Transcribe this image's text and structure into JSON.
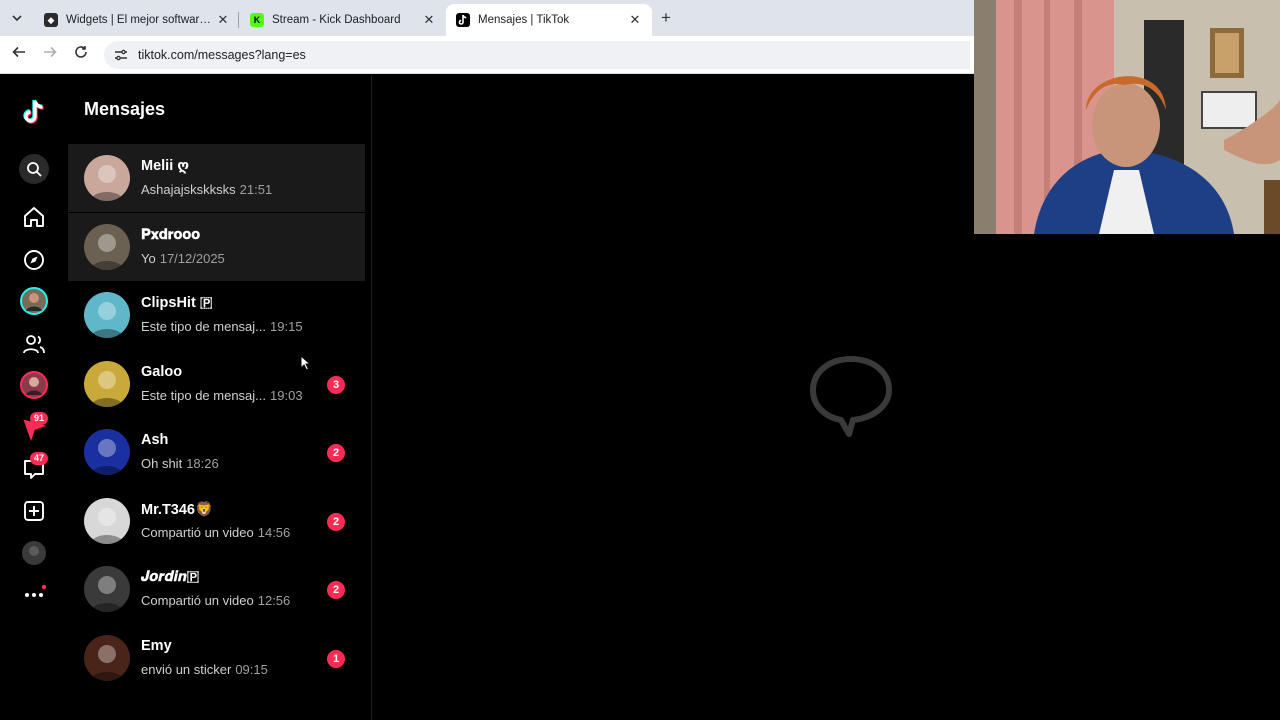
{
  "browser": {
    "tabs": [
      {
        "title": "Widgets | El mejor software pa",
        "favicon": "widgets-icon",
        "active": false
      },
      {
        "title": "Stream - Kick Dashboard",
        "favicon": "kick-icon",
        "active": false
      },
      {
        "title": "Mensajes | TikTok",
        "favicon": "tiktok-icon",
        "active": true
      }
    ],
    "close_glyph": "✕",
    "new_tab_glyph": "+",
    "url": "tiktok.com/messages?lang=es"
  },
  "app": {
    "title": "Mensajes",
    "rail": {
      "notifications_badge": "91",
      "inbox_badge": "47"
    },
    "conversations": [
      {
        "name": "Melii ღ",
        "preview": "Ashajajskskksks",
        "time": "21:51",
        "unread": "",
        "highlight": true,
        "avatar_color": "#c9a79a"
      },
      {
        "name": "𝐏𝐱𝐝𝐫𝐨𝐨𝐨",
        "preview": "Yo",
        "time": "17/12/2025",
        "unread": "",
        "highlight": true,
        "avatar_color": "#6b6152"
      },
      {
        "name": "ClipsHit 🇵",
        "preview": "Este tipo de mensaj...",
        "time": "19:15",
        "unread": "",
        "highlight": false,
        "avatar_color": "#5fb7c9"
      },
      {
        "name": "Galoo",
        "preview": "Este tipo de mensaj...",
        "time": "19:03",
        "unread": "3",
        "highlight": false,
        "avatar_color": "#c9a93a"
      },
      {
        "name": "Ash",
        "preview": "Oh shit",
        "time": "18:26",
        "unread": "2",
        "highlight": false,
        "avatar_color": "#1a2fa0"
      },
      {
        "name": "Mr.T346🦁",
        "preview": "Compartió un video",
        "time": "14:56",
        "unread": "2",
        "highlight": false,
        "avatar_color": "#d8d8d8"
      },
      {
        "name": "𝑱𝒐𝒓𝒅𝒊𝒏🇵",
        "preview": "Compartió un video",
        "time": "12:56",
        "unread": "2",
        "highlight": false,
        "avatar_color": "#3a3a3a"
      },
      {
        "name": "Emy",
        "preview": "envió un sticker",
        "time": "09:15",
        "unread": "1",
        "highlight": false,
        "avatar_color": "#4a2418"
      }
    ]
  },
  "colors": {
    "accent": "#fe2c55",
    "background": "#000000",
    "panel_highlight": "#1a1a1a"
  }
}
